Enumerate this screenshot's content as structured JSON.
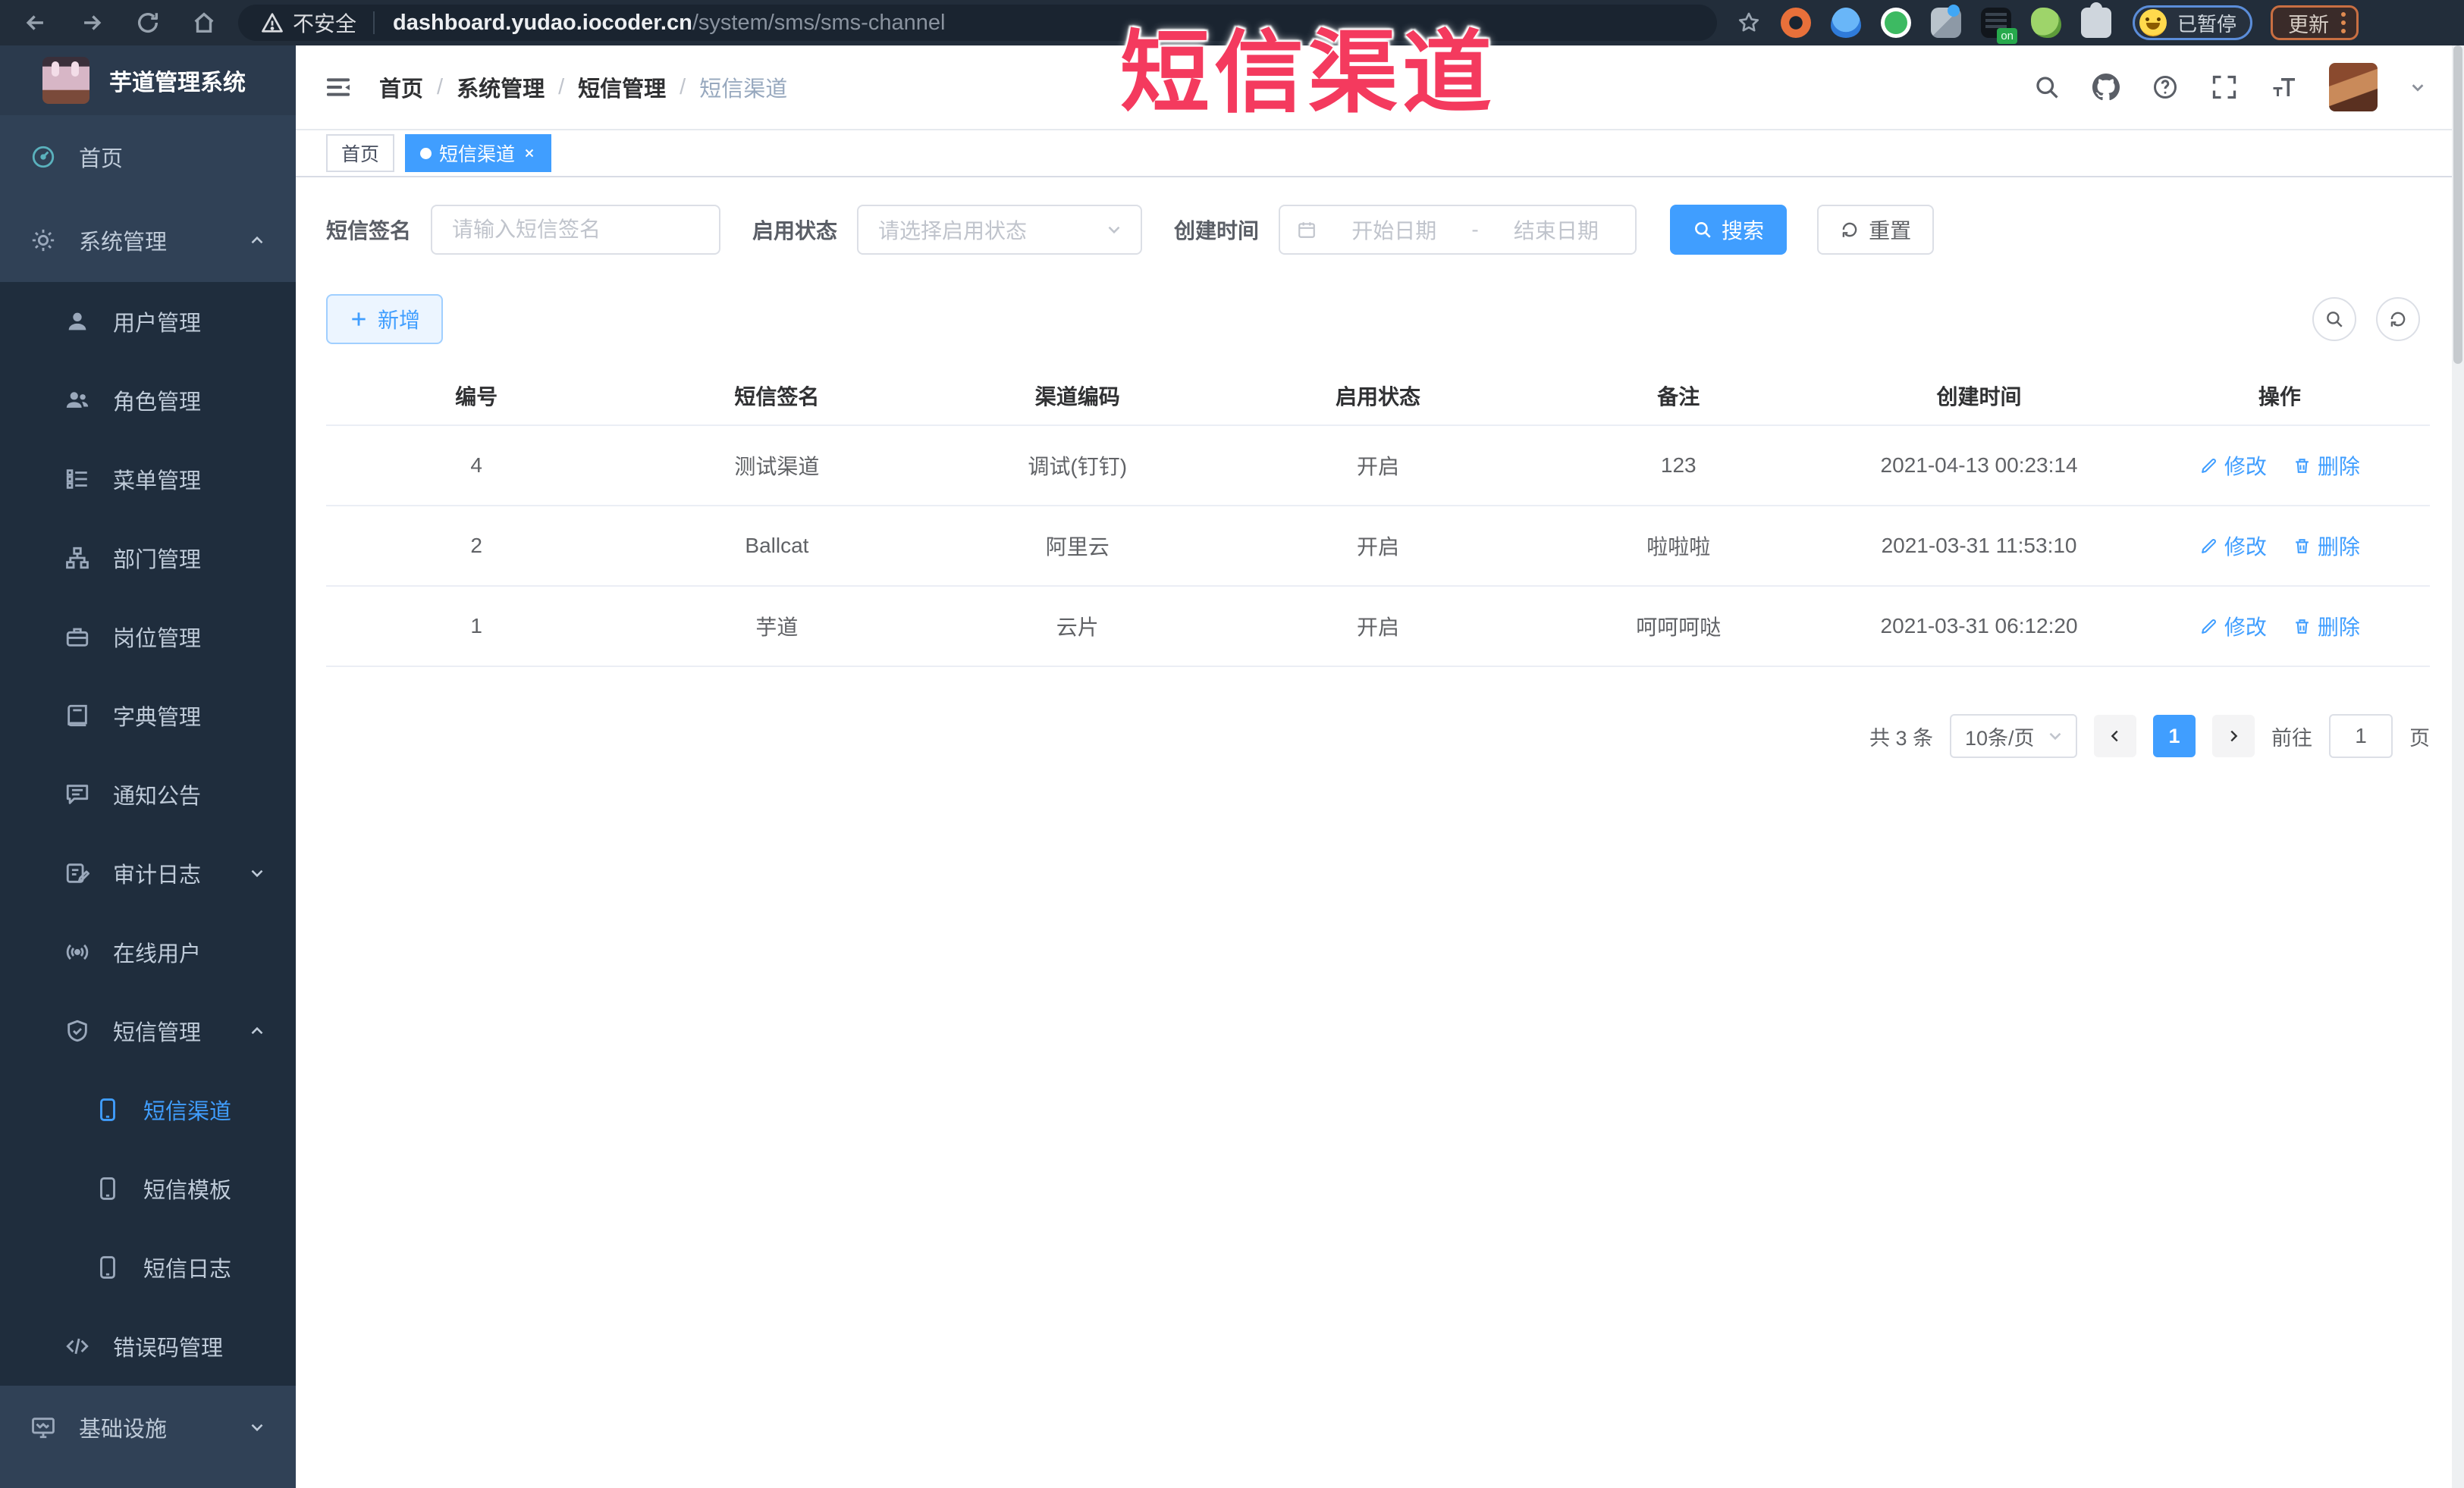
{
  "browser": {
    "security_label": "不安全",
    "url_domain": "dashboard.yudao.iocoder.cn",
    "url_path": "/system/sms/sms-channel",
    "paused_badge": "已暂停",
    "update_button": "更新"
  },
  "watermark": "短信渠道",
  "colors": {
    "accent": "#409eff",
    "watermark_red": "#f43a5e",
    "sidebar_bg": "#304156",
    "submenu_bg": "#1f2d3d"
  },
  "sidebar": {
    "logo_title": "芋道管理系统",
    "items": [
      {
        "label": "首页",
        "icon": "dashboard-icon",
        "level": 1
      },
      {
        "label": "系统管理",
        "icon": "gear-icon",
        "level": 1,
        "caret": "up"
      },
      {
        "label": "用户管理",
        "icon": "user-icon",
        "level": 2
      },
      {
        "label": "角色管理",
        "icon": "users-icon",
        "level": 2
      },
      {
        "label": "菜单管理",
        "icon": "menu-list-icon",
        "level": 2
      },
      {
        "label": "部门管理",
        "icon": "org-tree-icon",
        "level": 2
      },
      {
        "label": "岗位管理",
        "icon": "briefcase-icon",
        "level": 2
      },
      {
        "label": "字典管理",
        "icon": "book-icon",
        "level": 2
      },
      {
        "label": "通知公告",
        "icon": "message-icon",
        "level": 2
      },
      {
        "label": "审计日志",
        "icon": "log-icon",
        "level": 2,
        "caret": "down"
      },
      {
        "label": "在线用户",
        "icon": "signal-icon",
        "level": 2
      },
      {
        "label": "短信管理",
        "icon": "shield-icon",
        "level": 2,
        "caret": "up"
      },
      {
        "label": "短信渠道",
        "icon": "phone-icon",
        "level": 3,
        "active": true
      },
      {
        "label": "短信模板",
        "icon": "phone-icon",
        "level": 3
      },
      {
        "label": "短信日志",
        "icon": "phone-icon",
        "level": 3
      },
      {
        "label": "错误码管理",
        "icon": "code-icon",
        "level": 2
      },
      {
        "label": "基础设施",
        "icon": "monitor-icon",
        "level": 1,
        "caret": "down"
      }
    ]
  },
  "breadcrumb": {
    "separator": "/",
    "items": [
      "首页",
      "系统管理",
      "短信管理",
      "短信渠道"
    ]
  },
  "tabs": [
    {
      "label": "首页",
      "active": false
    },
    {
      "label": "短信渠道",
      "active": true
    }
  ],
  "filters": {
    "sign_label": "短信签名",
    "sign_placeholder": "请输入短信签名",
    "status_label": "启用状态",
    "status_placeholder": "请选择启用状态",
    "time_label": "创建时间",
    "start_placeholder": "开始日期",
    "range_separator": "-",
    "end_placeholder": "结束日期",
    "search_button": "搜索",
    "reset_button": "重置"
  },
  "toolbar": {
    "add_button": "新增"
  },
  "table": {
    "headers": [
      "编号",
      "短信签名",
      "渠道编码",
      "启用状态",
      "备注",
      "创建时间",
      "操作"
    ],
    "edit_label": "修改",
    "delete_label": "删除",
    "rows": [
      {
        "id": "4",
        "sign": "测试渠道",
        "code": "调试(钉钉)",
        "status": "开启",
        "remark": "123",
        "created": "2021-04-13 00:23:14"
      },
      {
        "id": "2",
        "sign": "Ballcat",
        "code": "阿里云",
        "status": "开启",
        "remark": "啦啦啦",
        "created": "2021-03-31 11:53:10"
      },
      {
        "id": "1",
        "sign": "芋道",
        "code": "云片",
        "status": "开启",
        "remark": "呵呵呵哒",
        "created": "2021-03-31 06:12:20"
      }
    ]
  },
  "pagination": {
    "total": "共 3 条",
    "page_size": "10条/页",
    "current_page": "1",
    "goto_label": "前往",
    "goto_value": "1",
    "page_unit": "页"
  }
}
